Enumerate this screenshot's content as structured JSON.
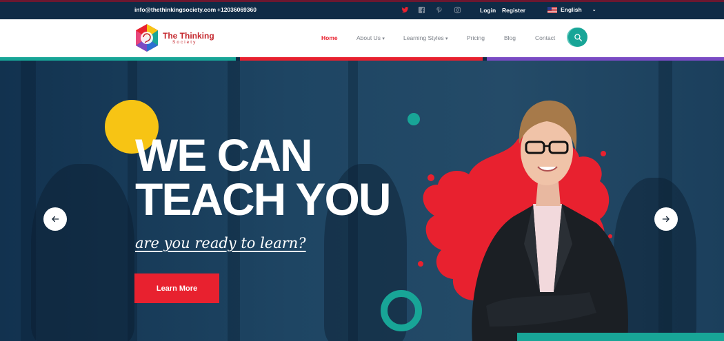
{
  "topbar": {
    "email": "info@thethinkingsociety.com",
    "phone": "+12036069360",
    "social": [
      {
        "icon": "twitter-icon",
        "color": "#e8212f"
      },
      {
        "icon": "facebook-icon",
        "color": "#7d8a99"
      },
      {
        "icon": "pinterest-icon",
        "color": "#7d8a99"
      },
      {
        "icon": "instagram-icon",
        "color": "#7d8a99"
      }
    ],
    "login_label": "Login",
    "register_label": "Register",
    "language": "English"
  },
  "brand": {
    "name": "The Thinking",
    "tagline": "Society"
  },
  "nav": {
    "items": [
      {
        "label": "Home",
        "active": true
      },
      {
        "label": "About Us",
        "dropdown": true
      },
      {
        "label": "Learning Styles",
        "dropdown": true
      },
      {
        "label": "Pricing"
      },
      {
        "label": "Blog"
      },
      {
        "label": "Contact"
      }
    ],
    "search_icon": "search-icon"
  },
  "hero": {
    "headline_line1": "WE CAN",
    "headline_line2": "TEACH YOU",
    "tagline": "are you ready to learn?",
    "cta_label": "Learn More",
    "prev_icon": "arrow-left-icon",
    "next_icon": "arrow-right-icon"
  },
  "colors": {
    "accent_red": "#e8212f",
    "teal": "#18a597",
    "yellow": "#f7c414",
    "navy": "#0f2b46",
    "purple": "#7a4bc4"
  }
}
